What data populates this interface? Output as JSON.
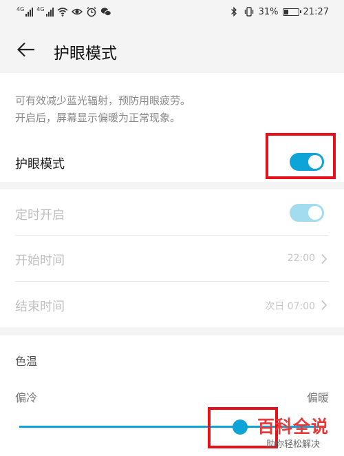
{
  "status_bar": {
    "net1": "4G",
    "net2": "4G",
    "battery_text": "31%",
    "battery_level": 0.31,
    "time": "21:27",
    "icons": [
      "signal-icon",
      "signal-icon",
      "wifi-icon",
      "eye-icon",
      "alarm-icon",
      "wechat-icon",
      "bluetooth-icon",
      "vibrate-icon",
      "battery-icon"
    ]
  },
  "header": {
    "title": "护眼模式"
  },
  "eye_mode": {
    "description_line1": "可有效减少蓝光辐射，预防用眼疲劳。",
    "description_line2": "开启后，屏幕显示偏暖为正常现象。",
    "label": "护眼模式",
    "enabled": true
  },
  "schedule": {
    "timer_label": "定时开启",
    "timer_enabled": true,
    "start_label": "开始时间",
    "start_value": "22:00",
    "end_label": "结束时间",
    "end_value": "次日 07:00"
  },
  "color_temp": {
    "label": "色温",
    "cold_label": "偏冷",
    "warm_label": "偏暖",
    "level": 0.72
  },
  "watermark": {
    "main": "百科全说",
    "sub": "助你轻松解决"
  },
  "colors": {
    "accent": "#0fa4d8",
    "highlight": "#e5101a"
  }
}
